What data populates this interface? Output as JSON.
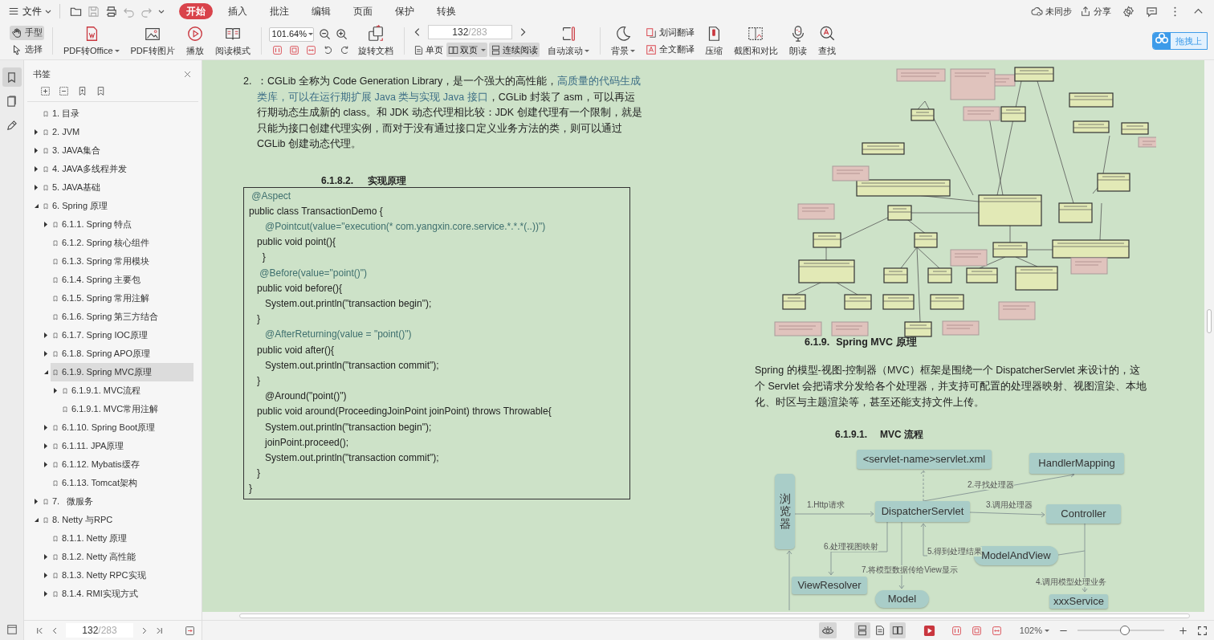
{
  "menu_bar": {
    "file_menu": "文件",
    "tabs": [
      {
        "label": "开始",
        "selected": true
      },
      {
        "label": "插入",
        "selected": false
      },
      {
        "label": "批注",
        "selected": false
      },
      {
        "label": "编辑",
        "selected": false
      },
      {
        "label": "页面",
        "selected": false
      },
      {
        "label": "保护",
        "selected": false
      },
      {
        "label": "转换",
        "selected": false
      }
    ],
    "sync_status": "未同步",
    "share": "分享"
  },
  "toolbar": {
    "items": [
      {
        "kind": "stack",
        "buttons": [
          {
            "label": "手型",
            "selected": true
          },
          {
            "label": "选择",
            "selected": false
          }
        ]
      },
      {
        "kind": "separator"
      },
      {
        "kind": "large",
        "label": "PDF转Office",
        "dropdown": true
      },
      {
        "kind": "large",
        "label": "PDF转图片",
        "dropdown": false
      },
      {
        "kind": "large",
        "label": "播放",
        "dropdown": false
      },
      {
        "kind": "large",
        "label": "阅读模式",
        "dropdown": false
      },
      {
        "kind": "separator"
      },
      {
        "kind": "zoom",
        "value": "101.64%"
      },
      {
        "kind": "large",
        "label": "旋转文档",
        "dropdown": false
      },
      {
        "kind": "separator"
      },
      {
        "kind": "pager",
        "current": "132",
        "total": "/283",
        "modes": [
          {
            "label": "单页",
            "selected": false,
            "dropdown": false
          },
          {
            "label": "双页",
            "selected": true,
            "dropdown": true
          },
          {
            "label": "连续阅读",
            "selected": true,
            "dropdown": false
          }
        ]
      },
      {
        "kind": "large",
        "label": "自动滚动",
        "dropdown": true
      },
      {
        "kind": "separator"
      },
      {
        "kind": "large",
        "label": "背景",
        "dropdown": true
      },
      {
        "kind": "stack",
        "buttons": [
          {
            "label": "划词翻译"
          },
          {
            "label": "全文翻译"
          }
        ]
      },
      {
        "kind": "large",
        "label": "压缩",
        "dropdown": false
      },
      {
        "kind": "large",
        "label": "截图和对比",
        "dropdown": false
      },
      {
        "kind": "large",
        "label": "朗读",
        "dropdown": false
      },
      {
        "kind": "large",
        "label": "查找",
        "dropdown": false
      }
    ],
    "cloud_button": "拖拽上"
  },
  "sidebar": {
    "rail": [
      {
        "selected": true
      },
      {
        "selected": false
      },
      {
        "selected": false
      }
    ],
    "title": "书签",
    "items": [
      {
        "label": "1. 目录",
        "has_children": false,
        "selected": false
      },
      {
        "label": "2. JVM",
        "has_children": true,
        "expanded": false,
        "selected": false
      },
      {
        "label": "3. JAVA集合",
        "has_children": true,
        "expanded": false,
        "selected": false
      },
      {
        "label": "4. JAVA多线程并发",
        "has_children": true,
        "expanded": false,
        "selected": false
      },
      {
        "label": "5. JAVA基础",
        "has_children": true,
        "expanded": false,
        "selected": false
      },
      {
        "label": "6. Spring 原理",
        "has_children": true,
        "expanded": true,
        "selected": false,
        "children": [
          {
            "label": "6.1.1. Spring 特点",
            "has_children": true,
            "expanded": false,
            "selected": false
          },
          {
            "label": "6.1.2. Spring 核心组件",
            "has_children": false,
            "selected": false
          },
          {
            "label": "6.1.3. Spring 常用模块",
            "has_children": false,
            "selected": false
          },
          {
            "label": "6.1.4. Spring 主要包",
            "has_children": false,
            "selected": false
          },
          {
            "label": "6.1.5. Spring 常用注解",
            "has_children": false,
            "selected": false
          },
          {
            "label": "6.1.6. Spring 第三方结合",
            "has_children": false,
            "selected": false
          },
          {
            "label": "6.1.7. Spring IOC原理",
            "has_children": true,
            "expanded": false,
            "selected": false
          },
          {
            "label": "6.1.8. Spring APO原理",
            "has_children": true,
            "expanded": false,
            "selected": false
          },
          {
            "label": "6.1.9. Spring MVC原理",
            "has_children": true,
            "expanded": true,
            "selected": true,
            "children": [
              {
                "label": "6.1.9.1. MVC流程",
                "has_children": true,
                "expanded": false,
                "selected": false
              },
              {
                "label": "6.1.9.1. MVC常用注解",
                "has_children": false,
                "selected": false
              }
            ]
          },
          {
            "label": "6.1.10. Spring Boot原理",
            "has_children": true,
            "expanded": false,
            "selected": false
          },
          {
            "label": "6.1.11. JPA原理",
            "has_children": true,
            "expanded": false,
            "selected": false
          },
          {
            "label": "6.1.12. Mybatis缓存",
            "has_children": true,
            "expanded": false,
            "selected": false
          },
          {
            "label": "6.1.13. Tomcat架构",
            "has_children": false,
            "selected": false
          }
        ]
      },
      {
        "label": "7.   微服务",
        "has_children": true,
        "expanded": false,
        "selected": false
      },
      {
        "label": "8. Netty 与RPC",
        "has_children": true,
        "expanded": true,
        "selected": false,
        "children": [
          {
            "label": "8.1.1. Netty 原理",
            "has_children": false,
            "selected": false
          },
          {
            "label": "8.1.2. Netty 高性能",
            "has_children": true,
            "expanded": false,
            "selected": false
          },
          {
            "label": "8.1.3. Netty RPC实现",
            "has_children": true,
            "expanded": false,
            "selected": false
          },
          {
            "label": "8.1.4. RMI实现方式",
            "has_children": true,
            "expanded": false,
            "selected": false
          }
        ]
      }
    ],
    "pager": {
      "current": "132",
      "total": "/283"
    }
  },
  "left_page": {
    "list_item": {
      "marker": "2.",
      "segments": [
        {
          "text": "：CGLib 全称为 Code Generation Library，是一个强大的高性能，",
          "highlighted": false
        },
        {
          "text": "高质量的代码生成类库，可以在运行期扩展 Java 类与实现 Java 接口",
          "highlighted": true
        },
        {
          "text": "，CGLib 封装了 asm，可以再运行期动态生成新的 class。和 JDK 动态代理相比较：JDK 创建代理有一个限制，就是只能为接口创建代理实例，而对于没有通过接口定义业务方法的类，则可以通过 CGLib 创建动态代理。",
          "highlighted": false
        }
      ]
    },
    "heading": {
      "number": "6.1.8.2.",
      "title": "实现原理"
    },
    "code": [
      {
        "text": " @Aspect",
        "kind": "annotation"
      },
      {
        "text": "public class TransactionDemo {",
        "kind": "code"
      },
      {
        "text": "      @Pointcut(value=\"execution(* com.yangxin.core.service.*.*.*(..))\")",
        "kind": "annotation"
      },
      {
        "text": "   public void point(){",
        "kind": "code"
      },
      {
        "text": "     }",
        "kind": "code"
      },
      {
        "text": "    @Before(value=\"point()\")",
        "kind": "annotation"
      },
      {
        "text": "   public void before(){",
        "kind": "code"
      },
      {
        "text": "      System.out.println(\"transaction begin\");",
        "kind": "code"
      },
      {
        "text": "   }",
        "kind": "code"
      },
      {
        "text": "      @AfterReturning(value = \"point()\")",
        "kind": "annotation"
      },
      {
        "text": "   public void after(){",
        "kind": "code"
      },
      {
        "text": "      System.out.println(\"transaction commit\");",
        "kind": "code"
      },
      {
        "text": "   }",
        "kind": "code"
      },
      {
        "text": "      @Around(\"point()\")",
        "kind": "code"
      },
      {
        "text": "   public void around(ProceedingJoinPoint joinPoint) throws Throwable{",
        "kind": "code"
      },
      {
        "text": "      System.out.println(\"transaction begin\");",
        "kind": "code"
      },
      {
        "text": "      joinPoint.proceed();",
        "kind": "code"
      },
      {
        "text": "      System.out.println(\"transaction commit\");",
        "kind": "code"
      },
      {
        "text": "   }",
        "kind": "code"
      },
      {
        "text": "}",
        "kind": "code"
      }
    ]
  },
  "right_page": {
    "heading": {
      "number": "6.1.9.",
      "title": "Spring MVC 原理"
    },
    "paragraph": "Spring 的模型-视图-控制器（MVC）框架是围绕一个 DispatcherServlet 来设计的，这个 Servlet 会把请求分发给各个处理器，并支持可配置的处理器映射、视图渲染、本地化、时区与主题渲染等，甚至还能支持文件上传。",
    "subheading": {
      "number": "6.1.9.1.",
      "title": "MVC 流程"
    },
    "diagram": {
      "nodes": [
        {
          "label": "<servlet-name>servlet.xml",
          "kind": "box"
        },
        {
          "label": "HandlerMapping",
          "kind": "box"
        },
        {
          "label": "浏览器",
          "kind": "vertical"
        },
        {
          "label": "DispatcherServlet",
          "kind": "box"
        },
        {
          "label": "Controller",
          "kind": "box"
        },
        {
          "label": "ModelAndView",
          "kind": "pill"
        },
        {
          "label": "ViewResolver",
          "kind": "box"
        },
        {
          "label": "Model",
          "kind": "pill"
        },
        {
          "label": "xxxService",
          "kind": "box"
        }
      ],
      "edge_labels": [
        "1.Http请求",
        "2.寻找处理器",
        "3.调用处理器",
        "4.调用模型处理业务",
        "5.得到处理结果",
        "6.处理视图映射",
        "7.将模型数据传给View显示"
      ]
    }
  },
  "status_bar": {
    "eye_protection": {
      "on": true
    },
    "view_modes": [
      {
        "selected": true
      },
      {
        "selected": false
      },
      {
        "selected": true
      }
    ],
    "zoom": "102%",
    "zoom_slider": {
      "level": 0.55
    }
  }
}
